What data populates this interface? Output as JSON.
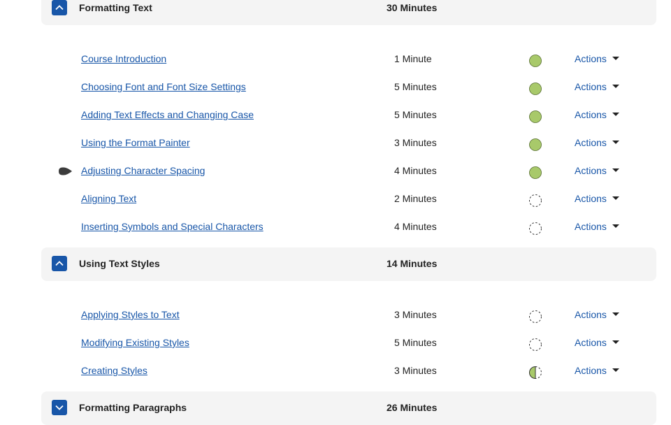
{
  "sections": [
    {
      "title": "Formatting Text",
      "duration": "30 Minutes",
      "expanded": true,
      "lessons": [
        {
          "title": "Course Introduction",
          "duration": "1 Minute",
          "status": "complete"
        },
        {
          "title": "Choosing Font and Font Size Settings",
          "duration": "5 Minutes",
          "status": "complete"
        },
        {
          "title": "Adding Text Effects and Changing Case",
          "duration": "5 Minutes",
          "status": "complete"
        },
        {
          "title": "Using the Format Painter",
          "duration": "3 Minutes",
          "status": "complete"
        },
        {
          "title": "Adjusting Character Spacing",
          "duration": "4 Minutes",
          "status": "complete",
          "current": true
        },
        {
          "title": "Aligning Text",
          "duration": "2 Minutes",
          "status": "not-started"
        },
        {
          "title": "Inserting Symbols and Special Characters",
          "duration": "4 Minutes",
          "status": "not-started"
        }
      ]
    },
    {
      "title": "Using Text Styles",
      "duration": "14 Minutes",
      "expanded": true,
      "lessons": [
        {
          "title": "Applying Styles to Text",
          "duration": "3 Minutes",
          "status": "not-started"
        },
        {
          "title": "Modifying Existing Styles",
          "duration": "5 Minutes",
          "status": "not-started"
        },
        {
          "title": "Creating Styles",
          "duration": "3 Minutes",
          "status": "in-progress"
        }
      ]
    },
    {
      "title": "Formatting Paragraphs",
      "duration": "26 Minutes",
      "expanded": false,
      "lessons": []
    }
  ],
  "actions_label": "Actions",
  "colors": {
    "complete": "#a8c96a",
    "link": "#1856a8",
    "toggle": "#1856a8",
    "header_bg": "#f4f4f4",
    "current_marker": "#3c3c3c"
  },
  "icons": {
    "expanded": "chevron-up-icon",
    "collapsed": "chevron-down-icon",
    "actions": "caret-down-icon",
    "current": "current-lesson-marker-icon"
  }
}
